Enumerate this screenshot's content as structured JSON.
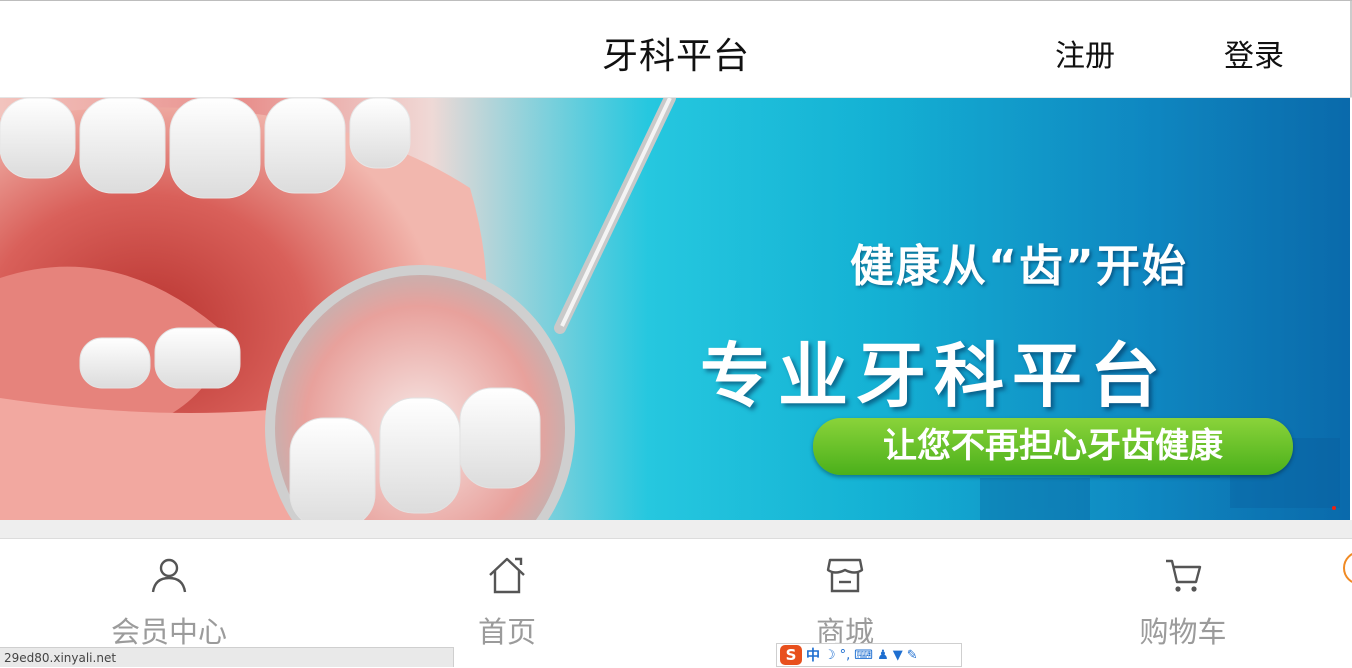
{
  "header": {
    "title": "牙科平台",
    "register_label": "注册",
    "login_label": "登录"
  },
  "banner": {
    "slogan_line1": "健康从“齿”开始",
    "slogan_line2": "专业牙科平台",
    "slogan_pill": "让您不再担心牙齿健康"
  },
  "tabbar": {
    "items": [
      {
        "label": "会员中心",
        "icon": "user-icon"
      },
      {
        "label": "首页",
        "icon": "home-icon"
      },
      {
        "label": "商城",
        "icon": "store-icon"
      },
      {
        "label": "购物车",
        "icon": "cart-icon"
      }
    ]
  },
  "statusbar": {
    "url": "29ed80.xinyali.net"
  },
  "ime": {
    "logo": "S",
    "mode": "中"
  },
  "colors": {
    "pill_green": "#5cbf24",
    "banner_blue": "#0fb6d6",
    "tab_label_gray": "#9b9b9b",
    "ime_orange": "#e8501d"
  }
}
